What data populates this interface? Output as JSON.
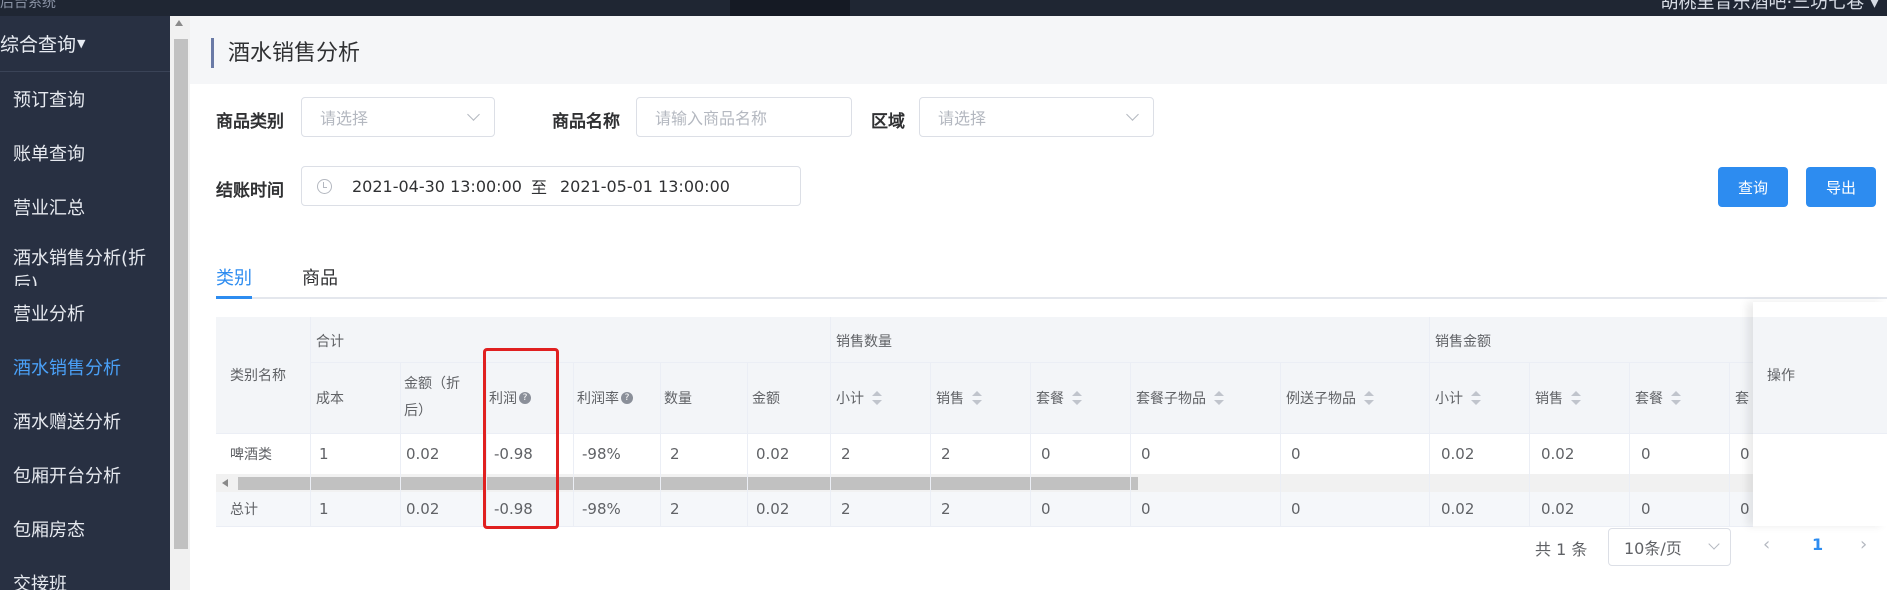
{
  "topbar": {
    "left_text": "后台系统",
    "right_text": "胡桃里音乐酒吧·三坊七巷 ▾"
  },
  "sidebar": {
    "section_title": "综合查询",
    "items": [
      {
        "label": "预订查询"
      },
      {
        "label": "账单查询"
      },
      {
        "label": "营业汇总"
      },
      {
        "label": "酒水销售分析(折后)"
      },
      {
        "label": "营业分析"
      },
      {
        "label": "酒水销售分析",
        "active": true
      },
      {
        "label": "酒水赠送分析"
      },
      {
        "label": "包厢开台分析"
      },
      {
        "label": "包厢房态"
      },
      {
        "label": "交接班"
      }
    ]
  },
  "page": {
    "title": "酒水销售分析"
  },
  "filters": {
    "category_label": "商品类别",
    "category_placeholder": "请选择",
    "name_label": "商品名称",
    "name_placeholder": "请输入商品名称",
    "area_label": "区域",
    "area_placeholder": "请选择",
    "time_label": "结账时间",
    "time_start": "2021-04-30 13:00:00",
    "time_sep": "至",
    "time_end": "2021-05-01 13:00:00",
    "query_button": "查询",
    "export_button": "导出"
  },
  "tabs": [
    {
      "label": "类别",
      "active": true
    },
    {
      "label": "商品"
    }
  ],
  "table": {
    "first_col_header": "类别名称",
    "group_headers": [
      "合计",
      "销售数量",
      "销售金额"
    ],
    "action_header": "操作",
    "sub_headers": [
      "成本",
      "金额（折后）",
      "利润",
      "利润率",
      "数量",
      "金额",
      "小计",
      "销售",
      "套餐",
      "套餐子物品",
      "例送子物品",
      "小计",
      "销售",
      "套餐",
      "套"
    ],
    "rows": [
      {
        "name": "啤酒类",
        "cells": [
          "1",
          "0.02",
          "-0.98",
          "-98%",
          "2",
          "0.02",
          "2",
          "2",
          "0",
          "0",
          "0",
          "0.02",
          "0.02",
          "0",
          "0"
        ]
      }
    ],
    "total": {
      "name": "总计",
      "cells": [
        "1",
        "0.02",
        "-0.98",
        "-98%",
        "2",
        "0.02",
        "2",
        "2",
        "0",
        "0",
        "0",
        "0.02",
        "0.02",
        "0",
        "0"
      ]
    }
  },
  "pagination": {
    "total_text": "共 1 条",
    "page_size": "10条/页",
    "prev": "‹",
    "current_page": "1",
    "next": "›"
  },
  "colors": {
    "accent": "#2d8cf0",
    "sidebar_bg": "#283042",
    "highlight": "#e02020"
  }
}
